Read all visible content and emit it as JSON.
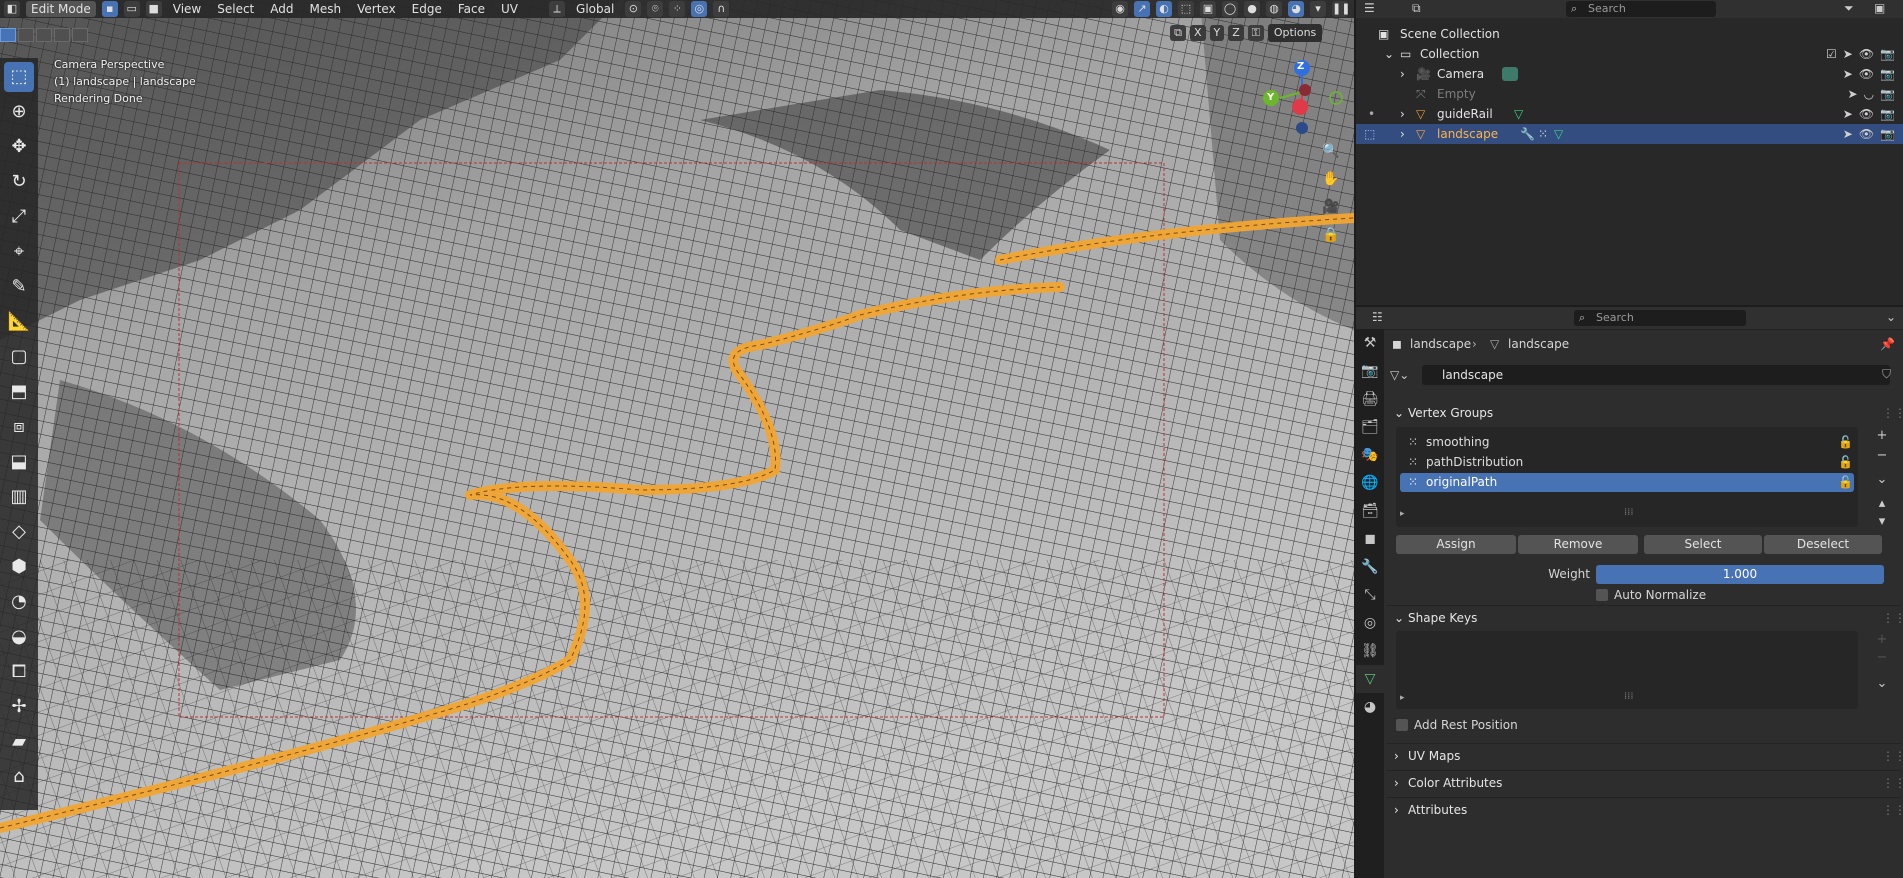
{
  "header": {
    "mode_label": "Edit Mode",
    "menus": [
      "View",
      "Select",
      "Add",
      "Mesh",
      "Vertex",
      "Edge",
      "Face",
      "UV"
    ],
    "orientation": "Global",
    "axes": [
      "X",
      "Y",
      "Z"
    ],
    "options_label": "Options"
  },
  "viewport": {
    "overlay_text": [
      "Camera Perspective",
      "(1) landscape | landscape",
      "Rendering Done"
    ],
    "gizmo": {
      "z": "Z",
      "y": "Y"
    },
    "colors": {
      "path": "#f2a531",
      "selection": "#4772b3",
      "terrain": "#b8b8b8"
    }
  },
  "outliner": {
    "search_placeholder": "Search",
    "scene_collection": "Scene Collection",
    "collection": "Collection",
    "objects": [
      {
        "name": "Camera",
        "icon": "camera-icon",
        "state": "normal"
      },
      {
        "name": "Empty",
        "icon": "empty-icon",
        "state": "hidden"
      },
      {
        "name": "guideRail",
        "icon": "mesh-icon",
        "state": "normal"
      },
      {
        "name": "landscape",
        "icon": "mesh-icon",
        "state": "selected"
      }
    ]
  },
  "properties": {
    "search_placeholder": "Search",
    "breadcrumb": [
      "landscape",
      "landscape"
    ],
    "mesh_name": "landscape",
    "vertex_groups": {
      "title": "Vertex Groups",
      "items": [
        "smoothing",
        "pathDistribution",
        "originalPath"
      ],
      "selected": "originalPath",
      "buttons": [
        "Assign",
        "Remove",
        "Select",
        "Deselect"
      ],
      "weight_label": "Weight",
      "weight_value": "1.000",
      "auto_normalize": "Auto Normalize"
    },
    "shape_keys": {
      "title": "Shape Keys",
      "add_rest": "Add Rest Position"
    },
    "collapsed_panels": [
      "UV Maps",
      "Color Attributes",
      "Attributes"
    ]
  }
}
